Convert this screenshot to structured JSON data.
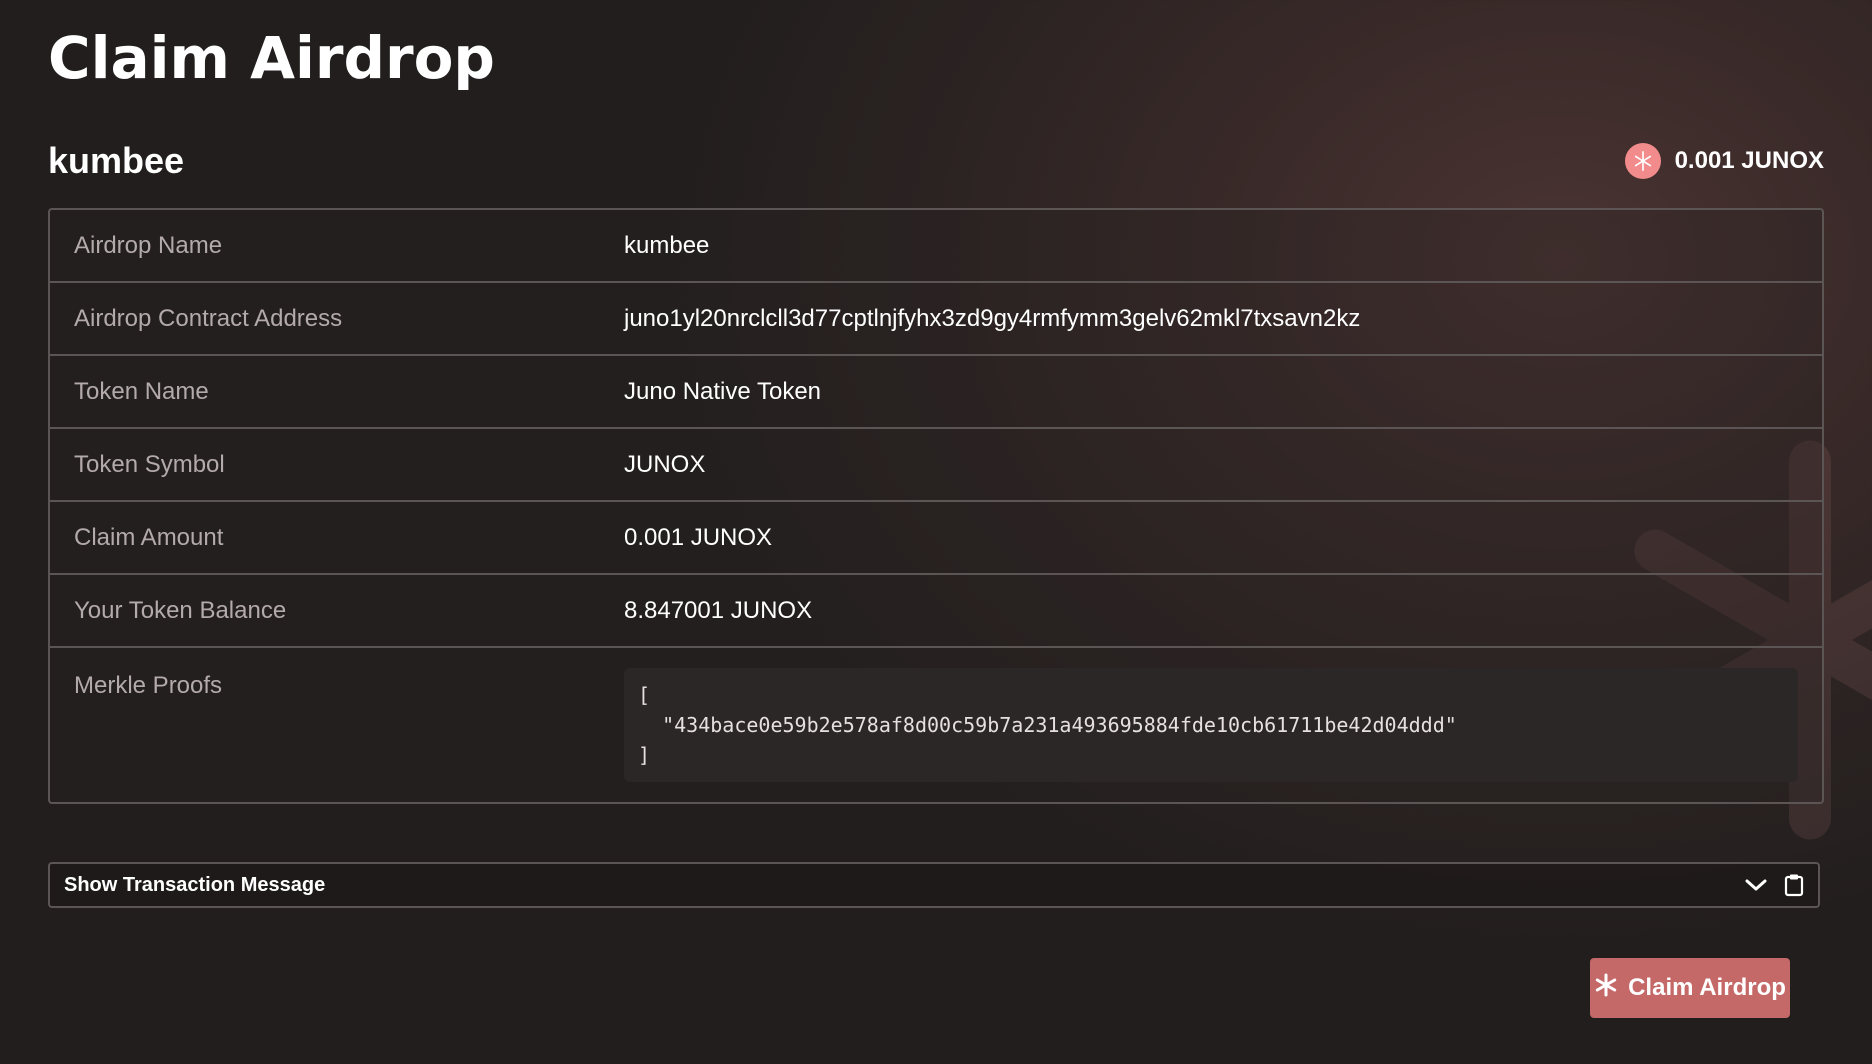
{
  "page": {
    "title": "Claim Airdrop"
  },
  "airdrop": {
    "heading": "kumbee",
    "amount_badge": "0.001 JUNOX",
    "token_icon": "juno-star-icon"
  },
  "details": [
    {
      "label": "Airdrop Name",
      "value": "kumbee"
    },
    {
      "label": "Airdrop Contract Address",
      "value": "juno1yl20nrclcll3d77cptlnjfyhx3zd9gy4rmfymm3gelv62mkl7txsavn2kz"
    },
    {
      "label": "Token Name",
      "value": "Juno Native Token"
    },
    {
      "label": "Token Symbol",
      "value": "JUNOX"
    },
    {
      "label": "Claim Amount",
      "value": "0.001 JUNOX"
    },
    {
      "label": "Your Token Balance",
      "value": "8.847001 JUNOX"
    },
    {
      "label": "Merkle Proofs",
      "value": "[\n  \"434bace0e59b2e578af8d00c59b7a231a493695884fde10cb61711be42d04ddd\"\n]"
    }
  ],
  "transaction": {
    "toggle_label": "Show Transaction Message",
    "expand_icon": "chevron-down-icon",
    "copy_icon": "clipboard-icon"
  },
  "actions": {
    "claim_label": "Claim Airdrop",
    "claim_icon": "asterisk-icon"
  },
  "colors": {
    "accent": "#c46868",
    "token_icon_bg": "#f28b8b",
    "border": "#5c5555",
    "label_text": "#b3aaaa"
  }
}
